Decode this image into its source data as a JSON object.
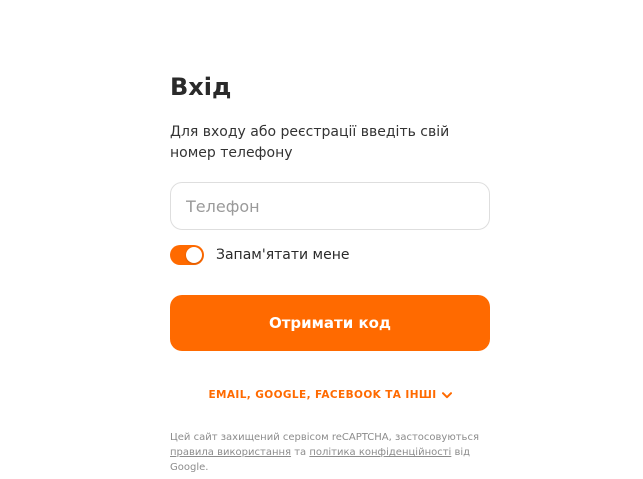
{
  "colors": {
    "accent": "#ff6a00",
    "text": "#2a2a2a",
    "muted": "#8c8c8c",
    "border": "#dedede"
  },
  "login": {
    "title": "Вхід",
    "subtitle": "Для входу або реєстрації введіть свій номер телефону",
    "phone": {
      "value": "",
      "placeholder": "Телефон"
    },
    "remember": {
      "label": "Запам'ятати мене",
      "checked": true
    },
    "submit_label": "Отримати код",
    "alt_methods": {
      "label": "EMAIL, GOOGLE, FACEBOOK ТА ІНШІ",
      "icon": "chevron-down-icon"
    },
    "recaptcha": {
      "prefix": "Цей сайт захищений сервісом reCAPTCHA, застосовуються ",
      "terms_link": "правила використання",
      "and": " та ",
      "privacy_link": "політика конфіденційності",
      "suffix": " від Google."
    }
  }
}
